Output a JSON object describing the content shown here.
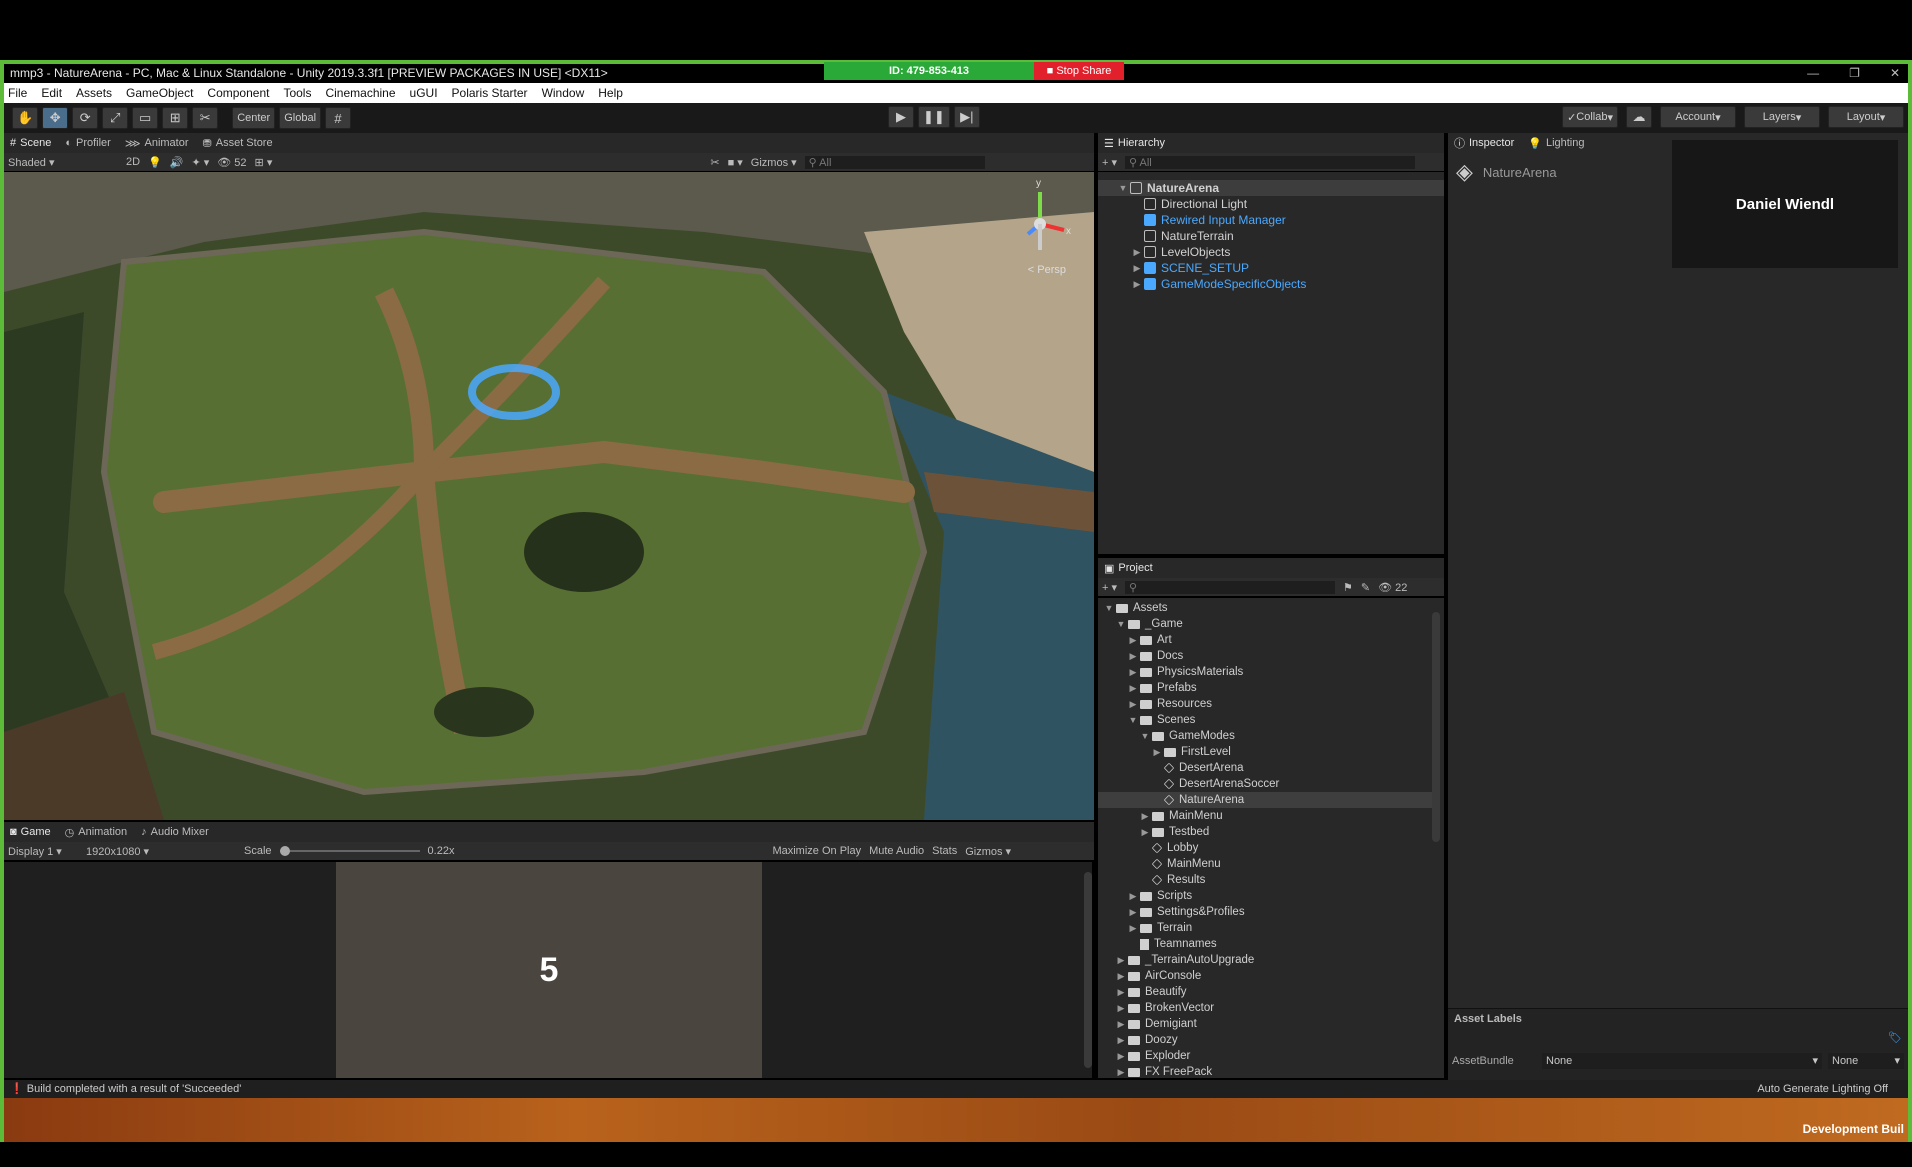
{
  "window": {
    "title": "mmp3 - NatureArena - PC, Mac & Linux Standalone - Unity 2019.3.3f1 [PREVIEW PACKAGES IN USE] <DX11>",
    "controls": [
      "—",
      "❐",
      "✕"
    ]
  },
  "share": {
    "id_label": "ID: 479-853-413",
    "stop_label": "Stop Share"
  },
  "menu": {
    "items": [
      "File",
      "Edit",
      "Assets",
      "GameObject",
      "Component",
      "Tools",
      "Cinemachine",
      "uGUI",
      "Polaris Starter",
      "Window",
      "Help"
    ]
  },
  "toolbar": {
    "pivot_label": "Center",
    "space_label": "Global",
    "collab_label": "Collab",
    "account_label": "Account",
    "layers_label": "Layers",
    "layout_label": "Layout"
  },
  "scene_panel": {
    "tabs": [
      "Scene",
      "Profiler",
      "Animator",
      "Asset Store"
    ],
    "shading": "Shaded",
    "mode_2d": "2D",
    "hidden_count": "52",
    "gizmos_label": "Gizmos",
    "search_placeholder": "All",
    "persp_label": "< Persp",
    "axis_y": "y",
    "axis_x": "x"
  },
  "game_panel": {
    "tabs": [
      "Game",
      "Animation",
      "Audio Mixer"
    ],
    "display": "Display 1",
    "resolution": "1920x1080",
    "scale_label": "Scale",
    "scale_value": "0.22x",
    "buttons": [
      "Maximize On Play",
      "Mute Audio",
      "Stats",
      "Gizmos"
    ],
    "countdown": "5"
  },
  "hierarchy": {
    "tab": "Hierarchy",
    "search_placeholder": "All",
    "rows": [
      {
        "label": "NatureArena",
        "depth": 0,
        "kind": "scene",
        "expanded": true
      },
      {
        "label": "Directional Light",
        "depth": 1,
        "kind": "object"
      },
      {
        "label": "Rewired Input Manager",
        "depth": 1,
        "kind": "prefab"
      },
      {
        "label": "NatureTerrain",
        "depth": 1,
        "kind": "object"
      },
      {
        "label": "LevelObjects",
        "depth": 1,
        "kind": "object",
        "collapsed": true
      },
      {
        "label": "SCENE_SETUP",
        "depth": 1,
        "kind": "prefab",
        "collapsed": true
      },
      {
        "label": "GameModeSpecificObjects",
        "depth": 1,
        "kind": "prefab",
        "collapsed": true
      }
    ]
  },
  "project": {
    "tab": "Project",
    "hidden_count": "22",
    "rows": [
      {
        "label": "Assets",
        "depth": 0,
        "kind": "folder",
        "state": "open"
      },
      {
        "label": "_Game",
        "depth": 1,
        "kind": "folder",
        "state": "open"
      },
      {
        "label": "Art",
        "depth": 2,
        "kind": "folder",
        "state": "closed"
      },
      {
        "label": "Docs",
        "depth": 2,
        "kind": "folder",
        "state": "closed"
      },
      {
        "label": "PhysicsMaterials",
        "depth": 2,
        "kind": "folder",
        "state": "closed"
      },
      {
        "label": "Prefabs",
        "depth": 2,
        "kind": "folder",
        "state": "closed"
      },
      {
        "label": "Resources",
        "depth": 2,
        "kind": "folder",
        "state": "closed"
      },
      {
        "label": "Scenes",
        "depth": 2,
        "kind": "folder",
        "state": "open"
      },
      {
        "label": "GameModes",
        "depth": 3,
        "kind": "folder",
        "state": "open"
      },
      {
        "label": "FirstLevel",
        "depth": 4,
        "kind": "folder",
        "state": "closed"
      },
      {
        "label": "DesertArena",
        "depth": 4,
        "kind": "scene"
      },
      {
        "label": "DesertArenaSoccer",
        "depth": 4,
        "kind": "scene"
      },
      {
        "label": "NatureArena",
        "depth": 4,
        "kind": "scene",
        "selected": true
      },
      {
        "label": "MainMenu",
        "depth": 3,
        "kind": "folder",
        "state": "closed"
      },
      {
        "label": "Testbed",
        "depth": 3,
        "kind": "folder",
        "state": "closed"
      },
      {
        "label": "Lobby",
        "depth": 3,
        "kind": "scene"
      },
      {
        "label": "MainMenu",
        "depth": 3,
        "kind": "scene"
      },
      {
        "label": "Results",
        "depth": 3,
        "kind": "scene"
      },
      {
        "label": "Scripts",
        "depth": 2,
        "kind": "folder",
        "state": "closed"
      },
      {
        "label": "Settings&Profiles",
        "depth": 2,
        "kind": "folder",
        "state": "closed"
      },
      {
        "label": "Terrain",
        "depth": 2,
        "kind": "folder",
        "state": "closed"
      },
      {
        "label": "Teamnames",
        "depth": 2,
        "kind": "file"
      },
      {
        "label": "_TerrainAutoUpgrade",
        "depth": 1,
        "kind": "folder",
        "state": "closed"
      },
      {
        "label": "AirConsole",
        "depth": 1,
        "kind": "folder",
        "state": "closed"
      },
      {
        "label": "Beautify",
        "depth": 1,
        "kind": "folder",
        "state": "closed"
      },
      {
        "label": "BrokenVector",
        "depth": 1,
        "kind": "folder",
        "state": "closed"
      },
      {
        "label": "Demigiant",
        "depth": 1,
        "kind": "folder",
        "state": "closed"
      },
      {
        "label": "Doozy",
        "depth": 1,
        "kind": "folder",
        "state": "closed"
      },
      {
        "label": "Exploder",
        "depth": 1,
        "kind": "folder",
        "state": "closed"
      },
      {
        "label": "FX FreePack",
        "depth": 1,
        "kind": "folder",
        "state": "closed"
      }
    ]
  },
  "inspector": {
    "tabs": [
      "Inspector",
      "Lighting"
    ],
    "object_name": "NatureArena",
    "asset_labels_title": "Asset Labels",
    "assetbundle_label": "AssetBundle",
    "assetbundle_value": "None",
    "variant_value": "None"
  },
  "presenter": {
    "name": "Daniel Wiendl"
  },
  "status": {
    "message": "Build completed with a result of 'Succeeded'",
    "lighting": "Auto Generate Lighting Off",
    "dev_build": "Development Buil"
  },
  "colors": {
    "accent_green": "#5dbb3a",
    "prefab_blue": "#4aa9ff",
    "stop_red": "#e2202c"
  }
}
